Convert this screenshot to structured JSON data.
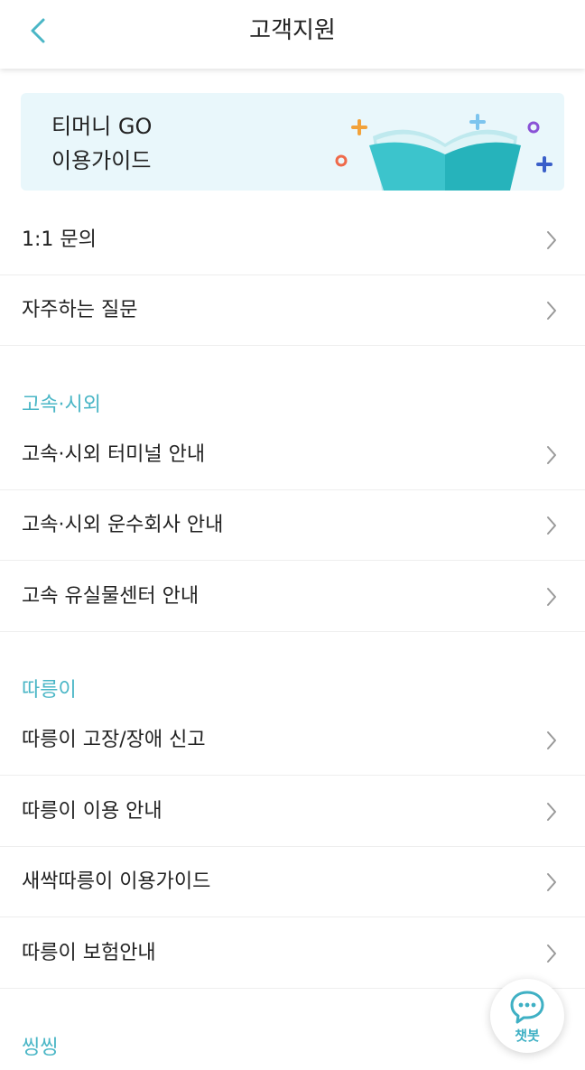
{
  "header": {
    "title": "고객지원"
  },
  "banner": {
    "line1": "티머니 GO",
    "line2": "이용가이드"
  },
  "top_items": [
    {
      "label": "1:1 문의"
    },
    {
      "label": "자주하는 질문"
    }
  ],
  "sections": [
    {
      "title": "고속·시외",
      "items": [
        {
          "label": "고속·시외 터미널 안내"
        },
        {
          "label": "고속·시외 운수회사 안내"
        },
        {
          "label": "고속 유실물센터 안내"
        }
      ]
    },
    {
      "title": "따릉이",
      "items": [
        {
          "label": "따릉이 고장/장애 신고"
        },
        {
          "label": "따릉이 이용 안내"
        },
        {
          "label": "새싹따릉이 이용가이드"
        },
        {
          "label": "따릉이 보험안내"
        }
      ]
    },
    {
      "title": "씽씽",
      "items": []
    }
  ],
  "chatbot": {
    "label": "챗봇"
  },
  "colors": {
    "accent": "#4ab6c6",
    "banner_bg": "#e9f7fb",
    "divider": "#eeeeee"
  }
}
